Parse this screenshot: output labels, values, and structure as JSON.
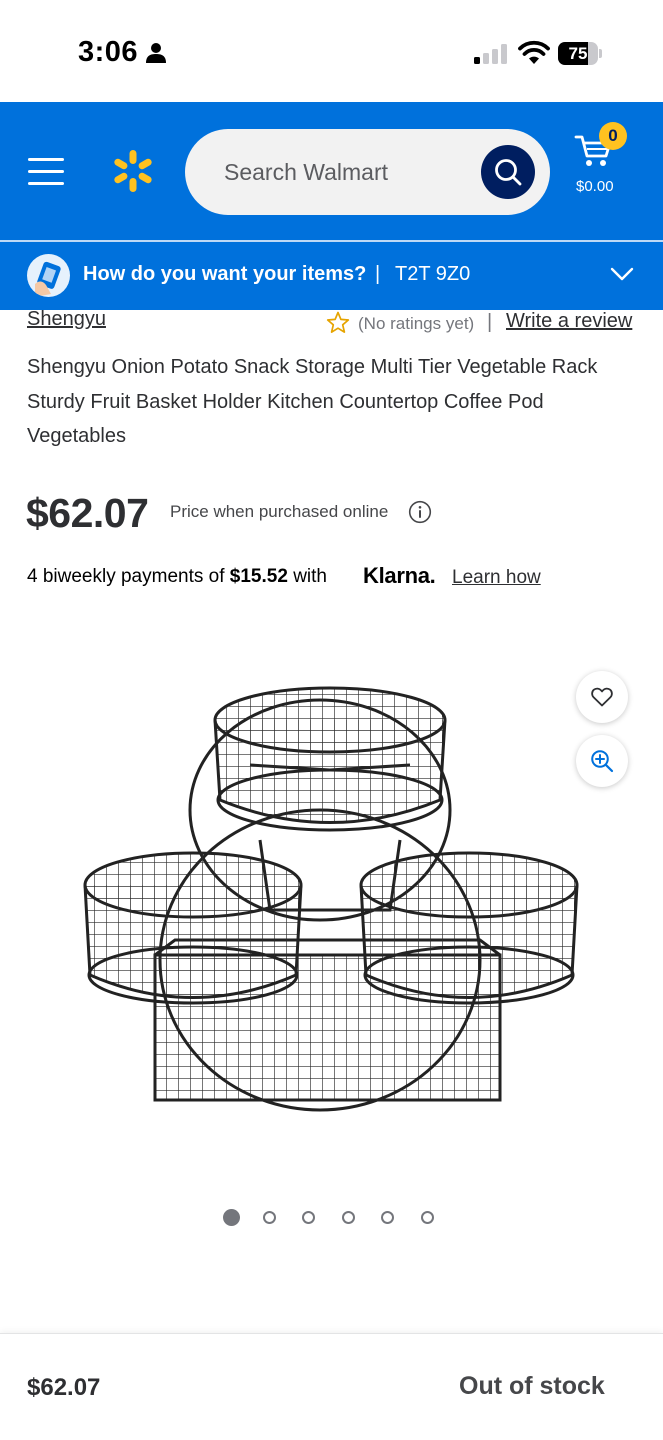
{
  "status_bar": {
    "time": "3:06",
    "battery_level": "75"
  },
  "header": {
    "search_placeholder": "Search Walmart",
    "cart_count": "0",
    "cart_total": "$0.00",
    "brand_color": "#0071dc",
    "spark_color": "#ffc220"
  },
  "delivery": {
    "prompt": "How do you want your items?",
    "separator": "|",
    "postal_code": "T2T 9Z0"
  },
  "product": {
    "brand": "Shengyu",
    "rating_text": "(No ratings yet)",
    "rating_separator": "|",
    "write_review": "Write a review",
    "title": "Shengyu Onion Potato Snack Storage Multi Tier Vegetable Rack Sturdy Fruit Basket Holder Kitchen Countertop Coffee Pod Vegetables",
    "price": "$62.07",
    "price_note": "Price when purchased online",
    "klarna_prefix": "4 biweekly payments of",
    "klarna_amount": "$15.52",
    "klarna_with": "with",
    "klarna_brand": "Klarna.",
    "learn_how": "Learn how"
  },
  "gallery": {
    "image_count": 6,
    "active_index": 0
  },
  "footer": {
    "price": "$62.07",
    "availability": "Out of stock"
  }
}
